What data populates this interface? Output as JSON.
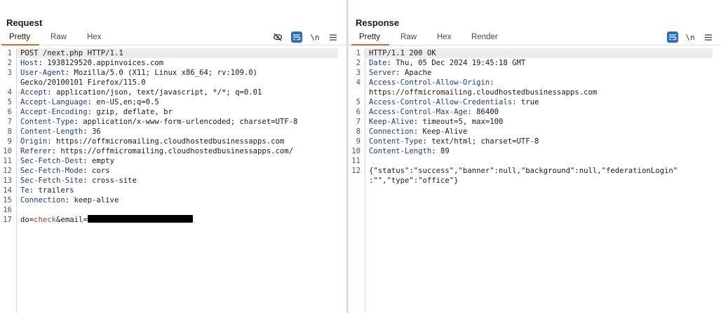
{
  "request": {
    "title": "Request",
    "tabs": [
      "Pretty",
      "Raw",
      "Hex"
    ],
    "active_tab": "Pretty",
    "tools": {
      "hide_icon": "eye-slash-icon",
      "wrap_icon": "wrap-icon",
      "newline_label": "\\n",
      "menu_icon": "hamburger-menu-icon"
    },
    "lines": [
      {
        "n": "1",
        "text": "POST /next.php HTTP/1.1"
      },
      {
        "n": "2",
        "name": "Host",
        "value": ": 1938129520.appinvoices.com"
      },
      {
        "n": "3",
        "name": "User-Agent",
        "value": ": Mozilla/5.0 (X11; Linux x86_64; rv:109.0)"
      },
      {
        "n": "",
        "text": "Gecko/20100101 Firefox/115.0"
      },
      {
        "n": "4",
        "name": "Accept",
        "value": ": application/json, text/javascript, */*; q=0.01"
      },
      {
        "n": "5",
        "name": "Accept-Language",
        "value": ": en-US,en;q=0.5"
      },
      {
        "n": "6",
        "name": "Accept-Encoding",
        "value": ": gzip, deflate, br"
      },
      {
        "n": "7",
        "name": "Content-Type",
        "value": ": application/x-www-form-urlencoded; charset=UTF-8"
      },
      {
        "n": "8",
        "name": "Content-Length",
        "value": ": 36"
      },
      {
        "n": "9",
        "name": "Origin",
        "value": ": https://offmicromailing.cloudhostedbusinessapps.com"
      },
      {
        "n": "10",
        "name": "Referer",
        "value": ": https://offmicromailing.cloudhostedbusinessapps.com/"
      },
      {
        "n": "11",
        "name": "Sec-Fetch-Dest",
        "value": ": empty"
      },
      {
        "n": "12",
        "name": "Sec-Fetch-Mode",
        "value": ": cors"
      },
      {
        "n": "13",
        "name": "Sec-Fetch-Site",
        "value": ": cross-site"
      },
      {
        "n": "14",
        "name": "Te",
        "value": ": trailers"
      },
      {
        "n": "15",
        "name": "Connection",
        "value": ": keep-alive"
      },
      {
        "n": "16",
        "text": ""
      },
      {
        "n": "17",
        "body": {
          "k1": "do",
          "v1": "check",
          "k2": "email",
          "redacted": true
        }
      }
    ]
  },
  "response": {
    "title": "Response",
    "tabs": [
      "Pretty",
      "Raw",
      "Hex",
      "Render"
    ],
    "active_tab": "Pretty",
    "tools": {
      "wrap_icon": "wrap-icon",
      "newline_label": "\\n",
      "menu_icon": "hamburger-menu-icon"
    },
    "lines": [
      {
        "n": "1",
        "text": "HTTP/1.1 200 OK"
      },
      {
        "n": "2",
        "name": "Date",
        "value": ": Thu, 05 Dec 2024 19:45:18 GMT"
      },
      {
        "n": "3",
        "name": "Server",
        "value": ": Apache"
      },
      {
        "n": "4",
        "name": "Access-Control-Allow-Origin",
        "value": ":"
      },
      {
        "n": "",
        "text": "https://offmicromailing.cloudhostedbusinessapps.com"
      },
      {
        "n": "5",
        "name": "Access-Control-Allow-Credentials",
        "value": ": true"
      },
      {
        "n": "6",
        "name": "Access-Control-Max-Age",
        "value": ": 86400"
      },
      {
        "n": "7",
        "name": "Keep-Alive",
        "value": ": timeout=5, max=100"
      },
      {
        "n": "8",
        "name": "Connection",
        "value": ": Keep-Alive"
      },
      {
        "n": "9",
        "name": "Content-Type",
        "value": ": text/html; charset=UTF-8"
      },
      {
        "n": "10",
        "name": "Content-Length",
        "value": ": 89"
      },
      {
        "n": "11",
        "text": ""
      },
      {
        "n": "12",
        "text": "{\"status\":\"success\",\"banner\":null,\"background\":null,\"federationLogin\""
      },
      {
        "n": "",
        "text": ":\"\",\"type\":\"office\"}"
      }
    ]
  },
  "layout_toggle": {
    "options": [
      "split-horizontal-icon",
      "split-vertical-icon",
      "single-pane-icon"
    ],
    "active": 0
  },
  "colors": {
    "accent_blue": "#2a6fc0",
    "header_name": "#1f3c88",
    "param_value": "#c0392b",
    "tab_underline": "#e0642a"
  }
}
